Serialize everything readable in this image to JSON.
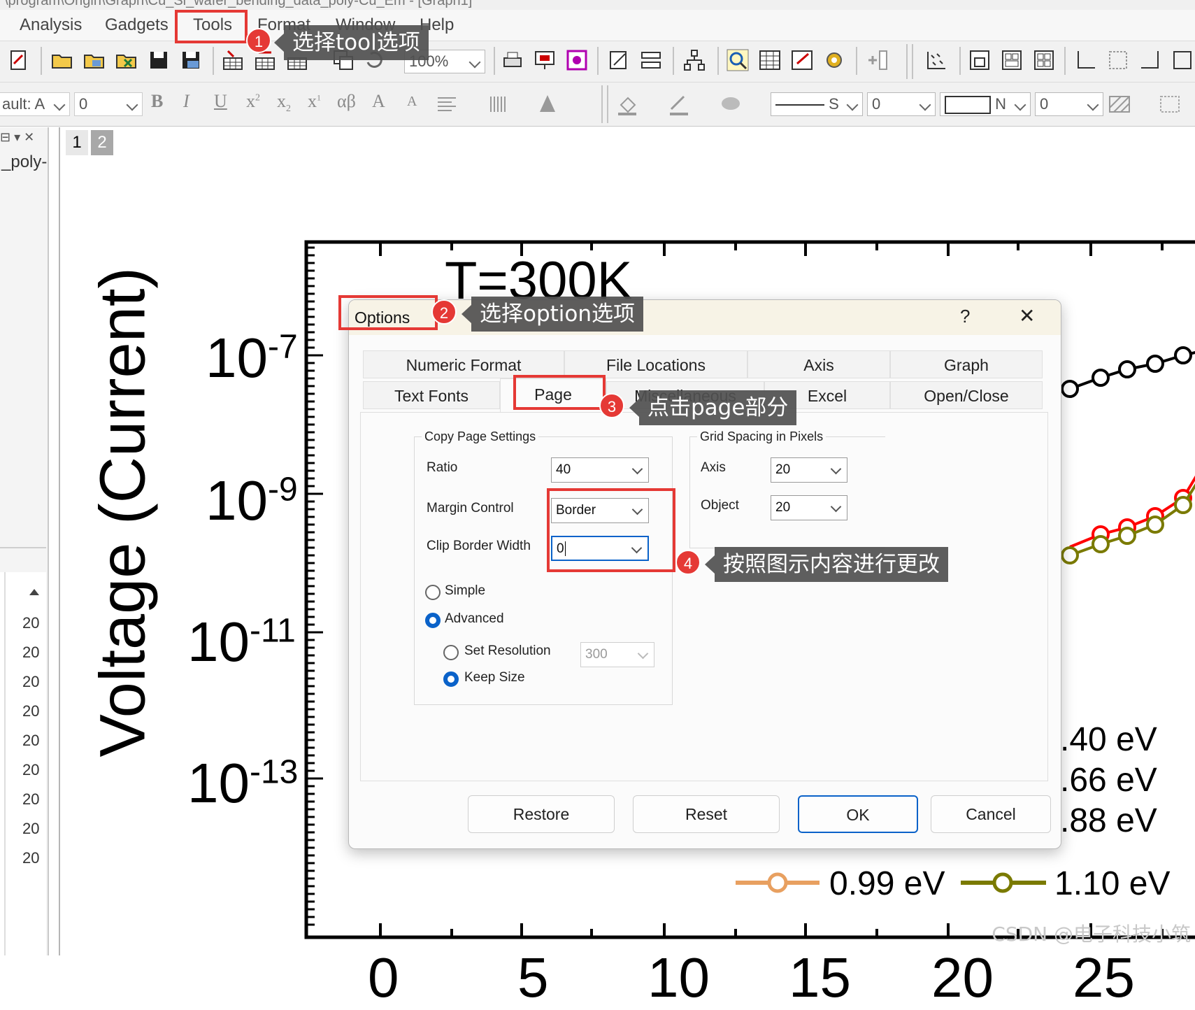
{
  "window": {
    "title_fragment": "\\program\\Origin\\Graph\\Cu_Si_wafer_bending_data_poly-Cu_Em - [Graph1]"
  },
  "menu": {
    "items": [
      "Analysis",
      "Gadgets",
      "Tools",
      "Format",
      "Window",
      "Help"
    ]
  },
  "toolbar": {
    "zoom": "100%",
    "font_name": "ault: A",
    "font_size": "0",
    "line_style": "S",
    "line_width": "0",
    "fill_label": "N",
    "fill_value": "0"
  },
  "left_panel": {
    "header_text": "_poly-",
    "rows": [
      "20",
      "20",
      "20",
      "20",
      "20",
      "20",
      "20",
      "20",
      "20"
    ]
  },
  "graph": {
    "pages": [
      "1",
      "2"
    ],
    "title_text": "T=300K",
    "ylabel": "Voltage (Current)",
    "ytick_labels": [
      {
        "base": "10",
        "exp": "-7"
      },
      {
        "base": "10",
        "exp": "-9"
      },
      {
        "base": "10",
        "exp": "-11"
      },
      {
        "base": "10",
        "exp": "-13"
      }
    ],
    "xtick_labels": [
      "0",
      "5",
      "10",
      "15",
      "20",
      "25"
    ],
    "legend": [
      ".40 eV",
      ".66 eV",
      ".88 eV",
      "0.99 eV",
      "1.10 eV"
    ],
    "colors": {
      "black": "#000000",
      "red": "#ff0000",
      "olive": "#7a7a00",
      "orange": "#e8a060",
      "cyan": "#00c0c0"
    }
  },
  "dialog": {
    "title": "Options",
    "help": "?",
    "close": "✕",
    "tabs_row1": [
      "Numeric Format",
      "File Locations",
      "Axis",
      "Graph"
    ],
    "tabs_row2": [
      "Text Fonts",
      "Page",
      "Miscellaneous",
      "Excel",
      "Open/Close"
    ],
    "copy_page": {
      "legend": "Copy Page Settings",
      "ratio_label": "Ratio",
      "ratio_value": "40",
      "margin_label": "Margin Control",
      "margin_value": "Border",
      "clip_label": "Clip Border Width",
      "clip_value": "0",
      "simple_label": "Simple",
      "advanced_label": "Advanced",
      "set_resolution_label": "Set Resolution",
      "resolution_value": "300",
      "keep_size_label": "Keep Size"
    },
    "grid": {
      "legend": "Grid Spacing in Pixels",
      "axis_label": "Axis",
      "axis_value": "20",
      "object_label": "Object",
      "object_value": "20"
    },
    "buttons": {
      "restore": "Restore",
      "reset": "Reset",
      "ok": "OK",
      "cancel": "Cancel"
    }
  },
  "annotations": {
    "step1": {
      "num": "1",
      "text": "选择tool选项"
    },
    "step2": {
      "num": "2",
      "text": "选择option选项"
    },
    "step3": {
      "num": "3",
      "text": "点击page部分"
    },
    "step4": {
      "num": "4",
      "text": "按照图示内容进行更改"
    }
  },
  "watermark": "CSDN @电子科技小筑"
}
